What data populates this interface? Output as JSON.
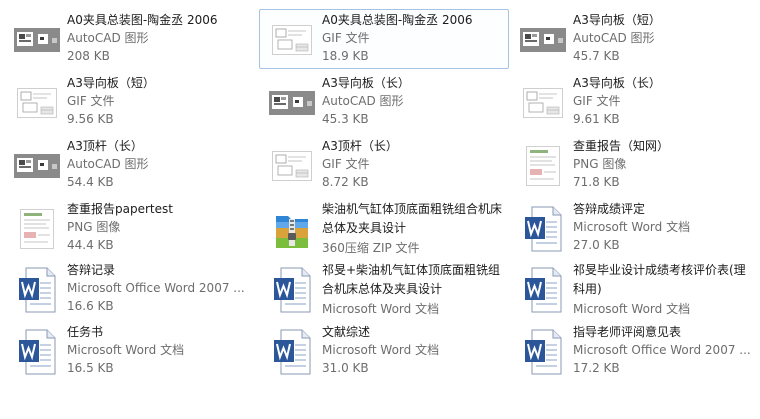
{
  "files": [
    {
      "name": "A0夹具总装图-陶金丞 2006",
      "type": "AutoCAD 图形",
      "size": "208 KB",
      "icon": "autocad-thumb-icon"
    },
    {
      "name": "A0夹具总装图-陶金丞 2006",
      "type": "GIF 文件",
      "size": "18.9 KB",
      "icon": "drawing-gif-thumb-icon",
      "selected": true
    },
    {
      "name": "A3导向板（短）",
      "type": "AutoCAD 图形",
      "size": "45.7 KB",
      "icon": "autocad-thumb-icon"
    },
    {
      "name": "A3导向板（短）",
      "type": "GIF 文件",
      "size": "9.56 KB",
      "icon": "drawing-gif-thumb-icon"
    },
    {
      "name": "A3导向板（长）",
      "type": "AutoCAD 图形",
      "size": "45.3 KB",
      "icon": "autocad-thumb-icon"
    },
    {
      "name": "A3导向板（长）",
      "type": "GIF 文件",
      "size": "9.61 KB",
      "icon": "drawing-gif-thumb-icon"
    },
    {
      "name": "A3顶杆（长）",
      "type": "AutoCAD 图形",
      "size": "54.4 KB",
      "icon": "autocad-thumb-icon"
    },
    {
      "name": "A3顶杆（长）",
      "type": "GIF 文件",
      "size": "8.72 KB",
      "icon": "drawing-gif-thumb-icon"
    },
    {
      "name": "查重报告（知网）",
      "type": "PNG 图像",
      "size": "71.8 KB",
      "icon": "png-report-thumb-icon"
    },
    {
      "name": "查重报告papertest",
      "type": "PNG 图像",
      "size": "44.4 KB",
      "icon": "png-report-thumb-icon"
    },
    {
      "name": "柴油机气缸体顶底面粗铣组合机床总体及夹具设计",
      "type": "360压缩 ZIP 文件",
      "size": "",
      "icon": "zip-archive-icon",
      "two": true
    },
    {
      "name": "答辩成绩评定",
      "type": "Microsoft Word 文档",
      "size": "27.0 KB",
      "icon": "word-document-icon"
    },
    {
      "name": "答辩记录",
      "type": "Microsoft Office Word 2007 ...",
      "size": "16.6 KB",
      "icon": "word-document-icon"
    },
    {
      "name": "祁旻+柴油机气缸体顶底面粗铣组合机床总体及夹具设计",
      "type": "Microsoft Word 文档",
      "size": "",
      "icon": "word-document-icon",
      "two": true
    },
    {
      "name": "祁旻毕业设计成绩考核评价表(理科用)",
      "type": "Microsoft Word 文档",
      "size": "",
      "icon": "word-document-icon",
      "two": true
    },
    {
      "name": "任务书",
      "type": "Microsoft Word 文档",
      "size": "16.5 KB",
      "icon": "word-document-icon"
    },
    {
      "name": "文献综述",
      "type": "Microsoft Word 文档",
      "size": "31.0 KB",
      "icon": "word-document-icon"
    },
    {
      "name": "指导老师评阅意见表",
      "type": "Microsoft Office Word 2007 ...",
      "size": "17.2 KB",
      "icon": "word-document-icon"
    }
  ],
  "colors": {
    "selection_border": "#a5c3e2",
    "word_blue": "#2b579a",
    "zip_blue": "#2f86d6",
    "zip_gold": "#d9a23a",
    "secondary_text": "#6d6d6d"
  }
}
